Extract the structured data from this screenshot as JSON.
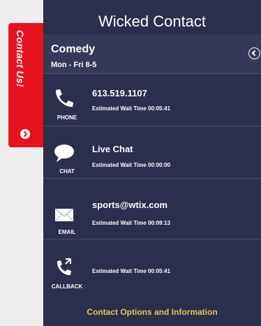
{
  "tab": {
    "label": "Contact Us!"
  },
  "panel": {
    "title": "Wicked Contact",
    "section": {
      "title": "Comedy",
      "hours": "Mon - Fri 8-5"
    },
    "rows": [
      {
        "icon": "phone-icon",
        "label": "PHONE",
        "value": "613.519.1107",
        "wait": "Estimated Wait Time 00:05:41"
      },
      {
        "icon": "chat-bubble-icon",
        "label": "CHAT",
        "value": "Live Chat",
        "wait": "Estimated Wait Time 00:00:00"
      },
      {
        "icon": "envelope-icon",
        "label": "EMAIL",
        "value": "sports@wtix.com",
        "wait": "Estimated Wait Time 00:09:13"
      },
      {
        "icon": "callback-phone-icon",
        "label": "CALLBACK",
        "value": "",
        "wait": "Estimated Wait Time 00:05:41"
      }
    ],
    "footer": "Contact Options and Information"
  },
  "colors": {
    "panel_bg": "#2b2e4d",
    "tab_red": "#e8121f",
    "footer_gold": "#e7c64e"
  }
}
